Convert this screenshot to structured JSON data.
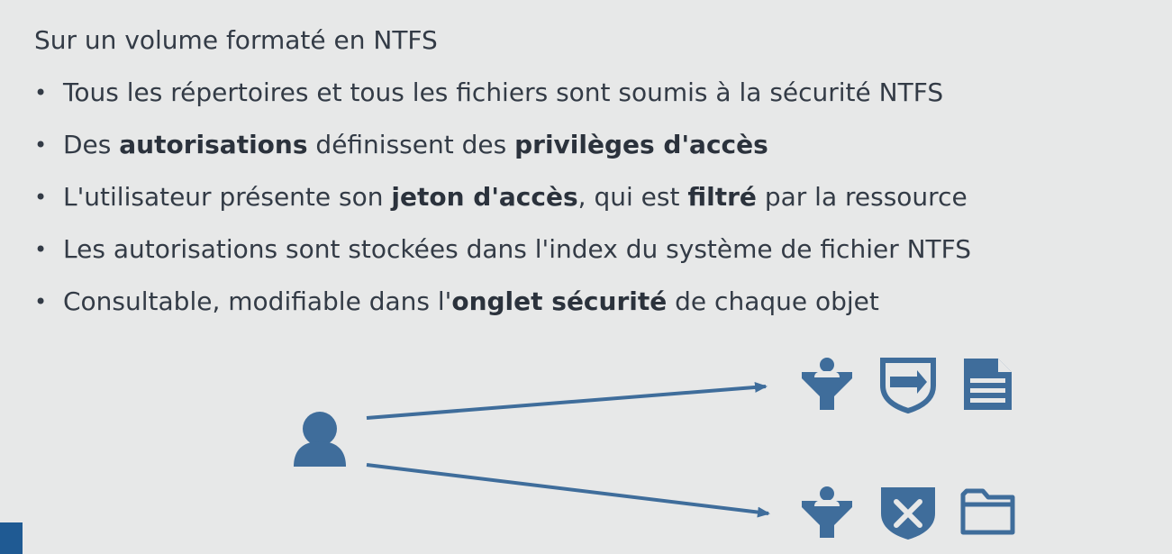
{
  "slide": {
    "heading": "Sur un volume formaté en NTFS",
    "bullets": [
      {
        "segments": [
          {
            "text": "Tous les répertoires et tous les fichiers sont soumis à la sécurité NTFS",
            "bold": false
          }
        ]
      },
      {
        "segments": [
          {
            "text": "Des ",
            "bold": false
          },
          {
            "text": "autorisations",
            "bold": true
          },
          {
            "text": " définissent des ",
            "bold": false
          },
          {
            "text": "privilèges d'accès",
            "bold": true
          }
        ]
      },
      {
        "segments": [
          {
            "text": "L'utilisateur présente son ",
            "bold": false
          },
          {
            "text": "jeton d'accès",
            "bold": true
          },
          {
            "text": ", qui est ",
            "bold": false
          },
          {
            "text": "filtré",
            "bold": true
          },
          {
            "text": " par la ressource",
            "bold": false
          }
        ]
      },
      {
        "segments": [
          {
            "text": "Les autorisations sont stockées dans l'index du système de fichier NTFS",
            "bold": false
          }
        ]
      },
      {
        "segments": [
          {
            "text": "Consultable, modifiable dans l'",
            "bold": false
          },
          {
            "text": "onglet sécurité",
            "bold": true
          },
          {
            "text": " de chaque objet",
            "bold": false
          }
        ]
      }
    ],
    "bullet_glyph": "•"
  },
  "diagram": {
    "accent_color": "#3f6d9b",
    "icons": {
      "user": "user-icon",
      "allowed_row": [
        "filter-user-icon",
        "shield-arrow-icon",
        "document-icon"
      ],
      "denied_row": [
        "filter-user-icon",
        "shield-x-icon",
        "folder-icon"
      ]
    }
  },
  "colors": {
    "background": "#e7e8e8",
    "text": "#333b46",
    "corner_mark": "#1f5a93"
  }
}
